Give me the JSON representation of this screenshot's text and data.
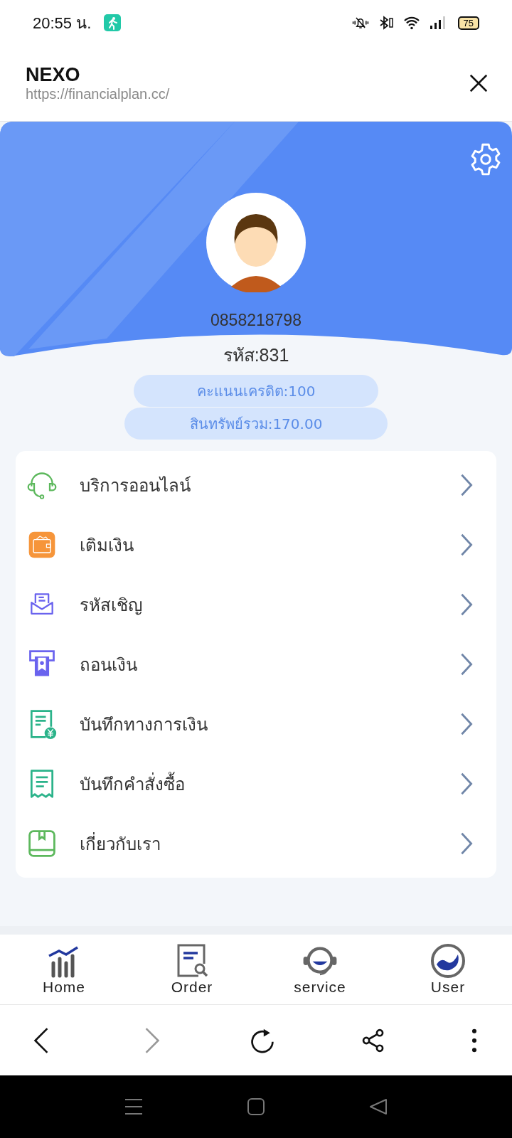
{
  "status_bar": {
    "time": "20:55 น.",
    "battery": "75"
  },
  "header": {
    "title": "NEXO",
    "url": "https://financialplan.cc/"
  },
  "profile": {
    "phone": "0858218798",
    "code": "รหัส:831",
    "credit": "คะแนนเครดิต:100",
    "assets": "สินทรัพย์รวม:170.00"
  },
  "menu": [
    {
      "label": "บริการออนไลน์"
    },
    {
      "label": "เติมเงิน"
    },
    {
      "label": "รหัสเชิญ"
    },
    {
      "label": "ถอนเงิน"
    },
    {
      "label": "บันทึกทางการเงิน"
    },
    {
      "label": "บันทึกคำสั่งซื้อ"
    },
    {
      "label": "เกี่ยวกับเรา"
    }
  ],
  "tabs": [
    {
      "label": "Home"
    },
    {
      "label": "Order"
    },
    {
      "label": "service"
    },
    {
      "label": "User"
    }
  ],
  "browser_nav": {
    "back_disabled": false,
    "forward_disabled": true
  }
}
